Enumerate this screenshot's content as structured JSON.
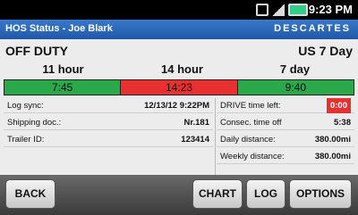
{
  "status_bar": {
    "time": "9:23 PM",
    "icons": [
      "usb-icon",
      "signal-icon",
      "battery-icon"
    ]
  },
  "title_bar": {
    "title": "HOS Status - Joe Blark",
    "brand": "DESCARTES"
  },
  "header": {
    "duty_status": "OFF DUTY",
    "cycle_rule": "US 7 Day"
  },
  "clocks": [
    {
      "label": "11 hour",
      "value": "7:45",
      "color": "#2aa84a"
    },
    {
      "label": "14 hour",
      "value": "14:23",
      "color": "#e83030"
    },
    {
      "label": "7 day",
      "value": "9:40",
      "color": "#2aa84a"
    }
  ],
  "details_left": [
    {
      "label": "Log sync:",
      "value": "12/13/12 9:22PM"
    },
    {
      "label": "Shipping doc.:",
      "value": "Nr.181"
    },
    {
      "label": "Trailer ID:",
      "value": "123414"
    }
  ],
  "details_right": [
    {
      "label": "DRIVE time left:",
      "value": "0:00",
      "alert": true
    },
    {
      "label": "Consec. time off",
      "value": "5:38"
    },
    {
      "label": "Daily distance:",
      "value": "380.00mi"
    },
    {
      "label": "Weekly distance:",
      "value": "380.00mi"
    }
  ],
  "buttons": {
    "back": "BACK",
    "chart": "CHART",
    "log": "LOG",
    "options": "OPTIONS"
  }
}
